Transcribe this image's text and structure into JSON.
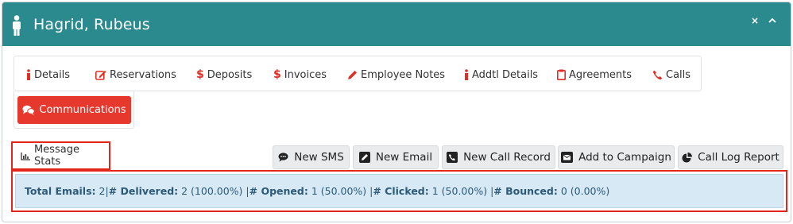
{
  "window": {
    "title": "Hagrid, Rubeus",
    "close_glyph": "×",
    "collapse_glyph": "^"
  },
  "tabs": [
    {
      "label": "Details",
      "icon": "info-icon"
    },
    {
      "label": "Reservations",
      "icon": "edit-icon"
    },
    {
      "label": "Deposits",
      "icon": "dollar-icon"
    },
    {
      "label": "Invoices",
      "icon": "dollar-icon"
    },
    {
      "label": "Employee Notes",
      "icon": "pencil-icon"
    },
    {
      "label": "Addtl Details",
      "icon": "info-icon"
    },
    {
      "label": "Agreements",
      "icon": "clipboard-icon"
    },
    {
      "label": "Calls",
      "icon": "phone-icon"
    }
  ],
  "communications_label": "Communications",
  "message_stats_label": "Message Stats",
  "actions": {
    "new_sms": "New SMS",
    "new_email": "New Email",
    "new_call_record": "New Call Record",
    "add_to_campaign": "Add to Campaign",
    "call_log_report": "Call Log Report"
  },
  "stats": {
    "total_emails_label": "Total Emails:",
    "total_emails_value": "2",
    "delivered_label": "# Delivered:",
    "delivered_value": "2 (100.00%)",
    "opened_label": "# Opened:",
    "opened_value": "1 (50.00%)",
    "clicked_label": "# Clicked:",
    "clicked_value": "1 (50.00%)",
    "bounced_label": "# Bounced:",
    "bounced_value": "0 (0.00%)",
    "separator": "|"
  },
  "colors": {
    "header": "#2b8a8d",
    "accent_red": "#e6382d",
    "alert_bg": "#d6e9f4",
    "alert_text": "#2d5a78"
  }
}
